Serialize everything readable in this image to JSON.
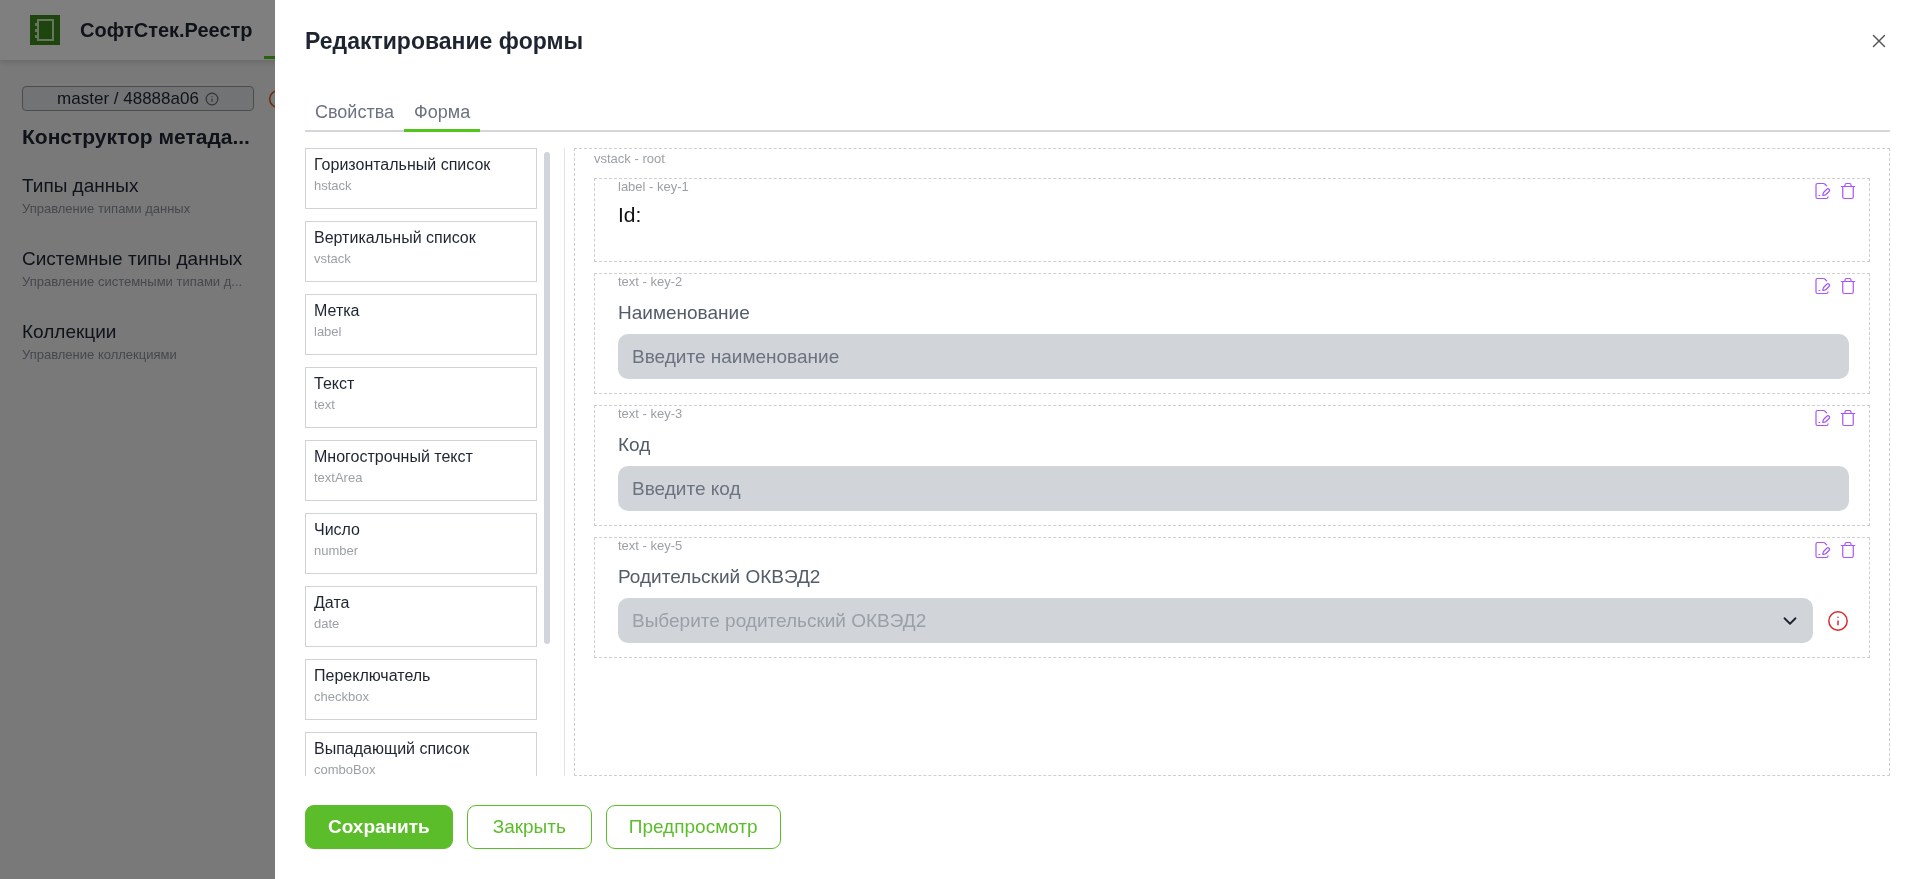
{
  "background": {
    "app_name": "СофтСтек.Реестр",
    "branch": "master / 48888a06",
    "page_title": "Конструктор метада...",
    "sections": [
      {
        "title": "Типы данных",
        "subtitle": "Управление типами данных"
      },
      {
        "title": "Системные типы данных",
        "subtitle": "Управление системными типами д..."
      },
      {
        "title": "Коллекции",
        "subtitle": "Управление коллекциями"
      }
    ]
  },
  "modal": {
    "title": "Редактирование формы",
    "tabs": [
      {
        "label": "Свойства",
        "selected": false
      },
      {
        "label": "Форма",
        "selected": true
      }
    ],
    "palette": [
      {
        "name": "Горизонтальный список",
        "type": "hstack"
      },
      {
        "name": "Вертикальный список",
        "type": "vstack"
      },
      {
        "name": "Метка",
        "type": "label"
      },
      {
        "name": "Текст",
        "type": "text"
      },
      {
        "name": "Многострочный текст",
        "type": "textArea"
      },
      {
        "name": "Число",
        "type": "number"
      },
      {
        "name": "Дата",
        "type": "date"
      },
      {
        "name": "Переключатель",
        "type": "checkbox"
      },
      {
        "name": "Выпадающий список",
        "type": "comboBox"
      }
    ],
    "canvas": {
      "root_tag": "vstack - root",
      "items": [
        {
          "kind": "label",
          "tag": "label - key-1",
          "text": "Id:"
        },
        {
          "kind": "input",
          "tag": "text - key-2",
          "label": "Наименование",
          "placeholder": "Введите наименование",
          "error": false
        },
        {
          "kind": "input",
          "tag": "text - key-3",
          "label": "Код",
          "placeholder": "Введите код",
          "error": false
        },
        {
          "kind": "select",
          "tag": "text - key-5",
          "label": "Родительский ОКВЭД2",
          "placeholder": "Выберите родительский ОКВЭД2",
          "error": true
        }
      ]
    },
    "buttons": [
      {
        "label": "Сохранить",
        "kind": "primary"
      },
      {
        "label": "Закрыть",
        "kind": "outline"
      },
      {
        "label": "Предпросмотр",
        "kind": "outline"
      }
    ]
  }
}
